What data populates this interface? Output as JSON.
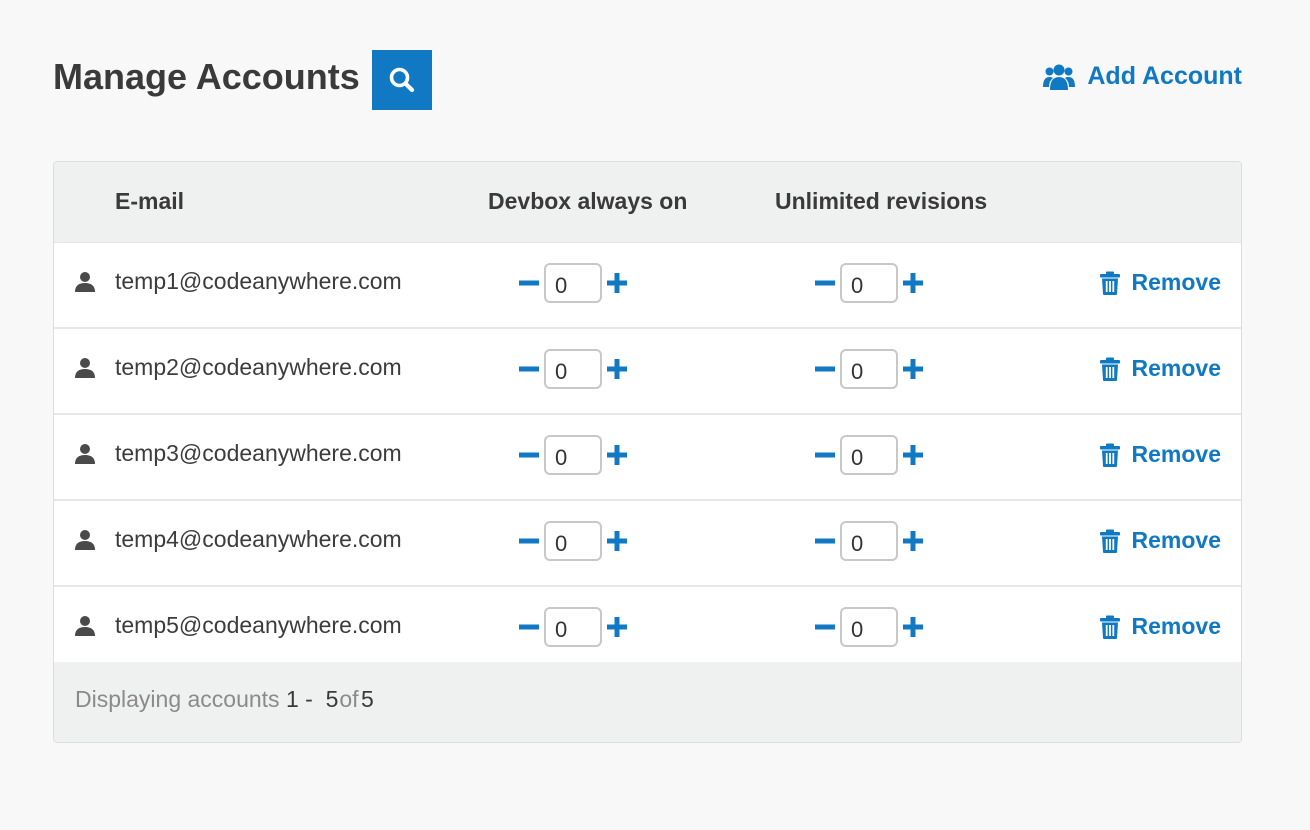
{
  "header": {
    "title": "Manage Accounts",
    "add_account_label": "Add Account"
  },
  "table": {
    "columns": [
      "E-mail",
      "Devbox always on",
      "Unlimited revisions"
    ],
    "remove_label": "Remove",
    "rows": [
      {
        "email": "temp1@codeanywhere.com",
        "devbox": "0",
        "revisions": "0"
      },
      {
        "email": "temp2@codeanywhere.com",
        "devbox": "0",
        "revisions": "0"
      },
      {
        "email": "temp3@codeanywhere.com",
        "devbox": "0",
        "revisions": "0"
      },
      {
        "email": "temp4@codeanywhere.com",
        "devbox": "0",
        "revisions": "0"
      },
      {
        "email": "temp5@codeanywhere.com",
        "devbox": "0",
        "revisions": "0"
      }
    ]
  },
  "footer": {
    "prefix": "Displaying accounts",
    "range_start": "1",
    "range_sep": "-",
    "range_end": "5",
    "of_label": "of",
    "total": "5"
  },
  "colors": {
    "accent": "#1179c3",
    "background": "#f8f8f8",
    "header_bg": "#eff0f0"
  },
  "icons": {
    "search": "search-icon",
    "add_account": "users-icon",
    "user": "user-icon",
    "minus": "minus-icon",
    "plus": "plus-icon",
    "trash": "trash-icon"
  }
}
